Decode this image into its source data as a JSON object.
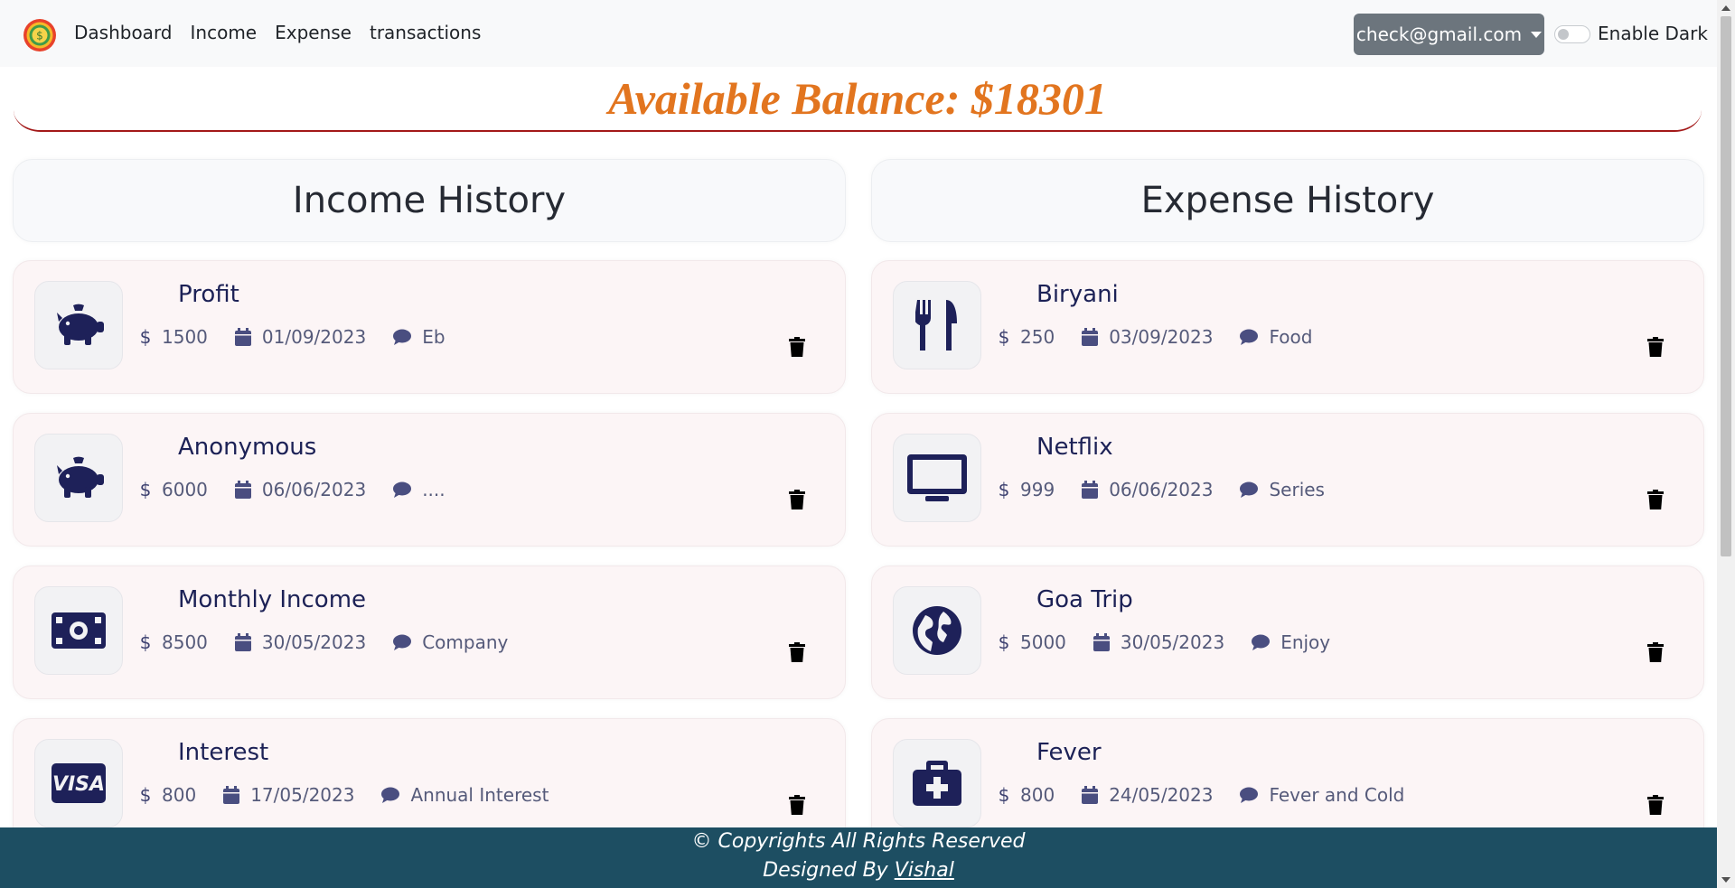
{
  "nav": {
    "links": [
      "Dashboard",
      "Income",
      "Expense",
      "transactions"
    ],
    "user_email": "check@gmail.com",
    "dark_toggle_label": "Enable Dark"
  },
  "balance": {
    "text": "Available Balance: $18301"
  },
  "income": {
    "header": "Income History",
    "items": [
      {
        "title": "Profit",
        "amount": "1500",
        "date": "01/09/2023",
        "note": "Eb",
        "icon": "piggy-bank-icon"
      },
      {
        "title": "Anonymous",
        "amount": "6000",
        "date": "06/06/2023",
        "note": "....",
        "icon": "piggy-bank-icon"
      },
      {
        "title": "Monthly Income",
        "amount": "8500",
        "date": "30/05/2023",
        "note": "Company",
        "icon": "money-bill-icon"
      },
      {
        "title": "Interest",
        "amount": "800",
        "date": "17/05/2023",
        "note": "Annual Interest",
        "icon": "visa-card-icon"
      }
    ]
  },
  "expense": {
    "header": "Expense History",
    "items": [
      {
        "title": "Biryani",
        "amount": "250",
        "date": "03/09/2023",
        "note": "Food",
        "icon": "utensils-icon"
      },
      {
        "title": "Netflix",
        "amount": "999",
        "date": "06/06/2023",
        "note": "Series",
        "icon": "laptop-icon"
      },
      {
        "title": "Goa Trip",
        "amount": "5000",
        "date": "30/05/2023",
        "note": "Enjoy",
        "icon": "globe-icon"
      },
      {
        "title": "Fever",
        "amount": "800",
        "date": "24/05/2023",
        "note": "Fever and Cold",
        "icon": "medical-kit-icon"
      }
    ]
  },
  "footer": {
    "line1": "© Copyrights All Rights Reserved",
    "designed_by": "Designed By ",
    "author": "Vishal"
  },
  "colors": {
    "balance": "#e2751f",
    "navy": "#1e2159",
    "footer_bg": "#1d4e62",
    "card_bg": "#fcf5f6",
    "user_button": "#6c757d"
  }
}
